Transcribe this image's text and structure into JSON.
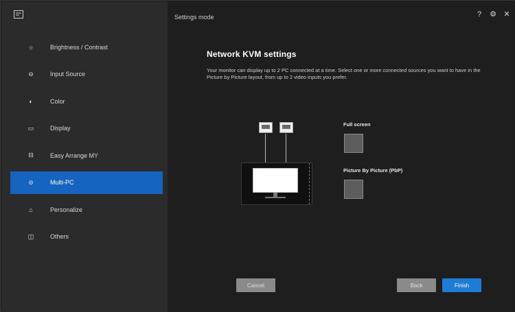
{
  "app": {
    "window_title": "Settings mode",
    "icon": "dell-logo-icon"
  },
  "window_controls": [
    {
      "name": "help-icon",
      "glyph": "?"
    },
    {
      "name": "settings-icon",
      "glyph": "⚙"
    },
    {
      "name": "close-icon",
      "glyph": "✕"
    }
  ],
  "sidebar": {
    "items": [
      {
        "label": "Brightness / Contrast",
        "icon": "brightness-icon",
        "glyph": "☼",
        "active": false
      },
      {
        "label": "Input Source",
        "icon": "input-source-icon",
        "glyph": "⊖",
        "active": false
      },
      {
        "label": "Color",
        "icon": "color-icon",
        "glyph": "◐",
        "active": false
      },
      {
        "label": "Display",
        "icon": "display-icon",
        "glyph": "▭",
        "active": false
      },
      {
        "label": "Easy Arrange MY",
        "icon": "easy-arrange-icon",
        "glyph": "⊟",
        "active": false
      },
      {
        "label": "Multi-PC",
        "icon": "kvm-icon",
        "glyph": "⊜",
        "active": true
      },
      {
        "label": "Personalize",
        "icon": "personalize-icon",
        "glyph": "⌂",
        "active": false
      },
      {
        "label": "Others",
        "icon": "others-icon",
        "glyph": "◫",
        "active": false
      }
    ]
  },
  "main": {
    "heading": "Network KVM settings",
    "description": "Your monitor can display up to 2 PC connected at a time. Select one or more connected sources you want to have in the Picture by Picture layout, from up to 2 video inputs you prefer."
  },
  "options": {
    "full_screen_label": "Full screen",
    "pbp_label": "Picture By Picture (PbP)"
  },
  "buttons": {
    "cancel": "Cancel",
    "back": "Back",
    "finish": "Finish"
  }
}
